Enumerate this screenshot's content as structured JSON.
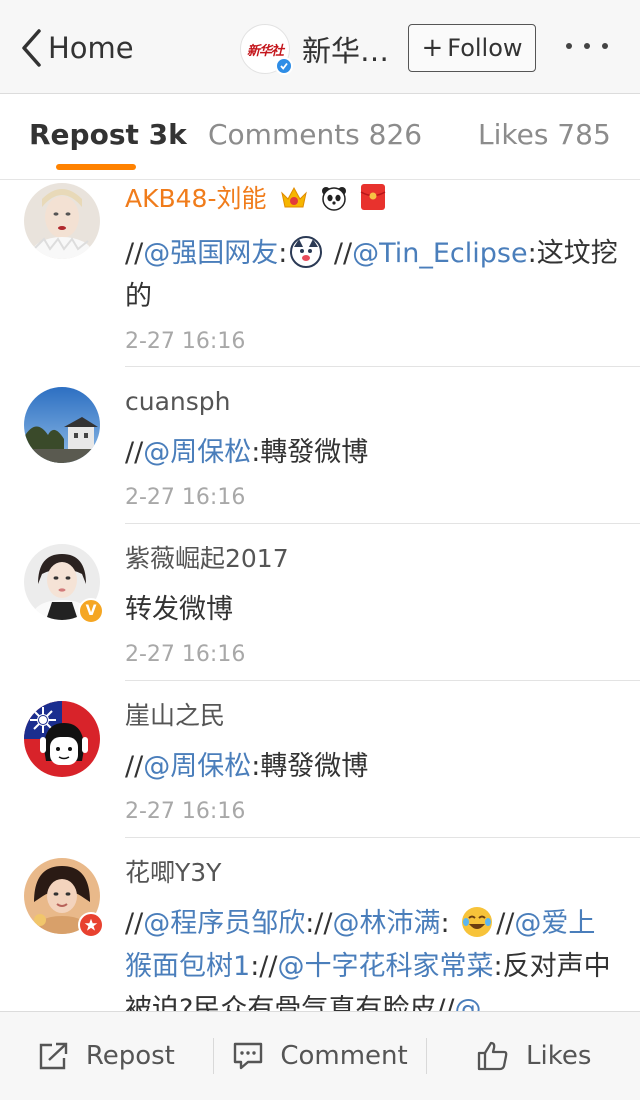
{
  "nav": {
    "back_label": "Home",
    "account_name": "新华…",
    "logo_text": "新华社",
    "follow_label": "Follow",
    "more_icon": "ellipsis-icon"
  },
  "tabs": [
    {
      "label": "Repost 3k",
      "active": true
    },
    {
      "label": "Comments 826",
      "active": false
    },
    {
      "label": "Likes 785",
      "active": false
    }
  ],
  "reposts": [
    {
      "user": "AKB48-刘能",
      "badges": [
        "crown-icon",
        "panda-icon",
        "red-envelope-icon"
      ],
      "content": {
        "p1": "//",
        "m1": "@强国网友",
        "p2": ":",
        "p3": " //",
        "m2": "@Tin_Eclipse",
        "p4": ":这坟挖的"
      },
      "time": "2-27 16:16"
    },
    {
      "user": "cuansph",
      "content": {
        "p1": "//",
        "m1": "@周保松",
        "p2": ":轉發微博"
      },
      "time": "2-27 16:16"
    },
    {
      "user": "紫薇崛起2017",
      "verified": "V",
      "content": {
        "p1": "转发微博"
      },
      "time": "2-27 16:16"
    },
    {
      "user": "崖山之民",
      "content": {
        "p1": "//",
        "m1": "@周保松",
        "p2": ":轉發微博"
      },
      "time": "2-27 16:16"
    },
    {
      "user": "花唧Y3Y",
      "content": {
        "p1": "//",
        "m1": "@程序员邹欣",
        "p2": "://",
        "m2": "@林沛满",
        "p3": ": ",
        "p4": "//",
        "m3": "@爱上猴面包树1",
        "p5": "://",
        "m4": "@十字花科家常菜",
        "p6": ":反对声中被迫?民众有骨气真有脸皮//",
        "m5": "@"
      },
      "time": ""
    }
  ],
  "toolbar": {
    "repost_label": "Repost",
    "comment_label": "Comment",
    "likes_label": "Likes"
  },
  "colors": {
    "accent": "#ff8200",
    "mention": "#4a7ebb",
    "vip_name": "#f07c1b",
    "verified_blue": "#2e8de6",
    "verified_orange": "#f5a623"
  }
}
